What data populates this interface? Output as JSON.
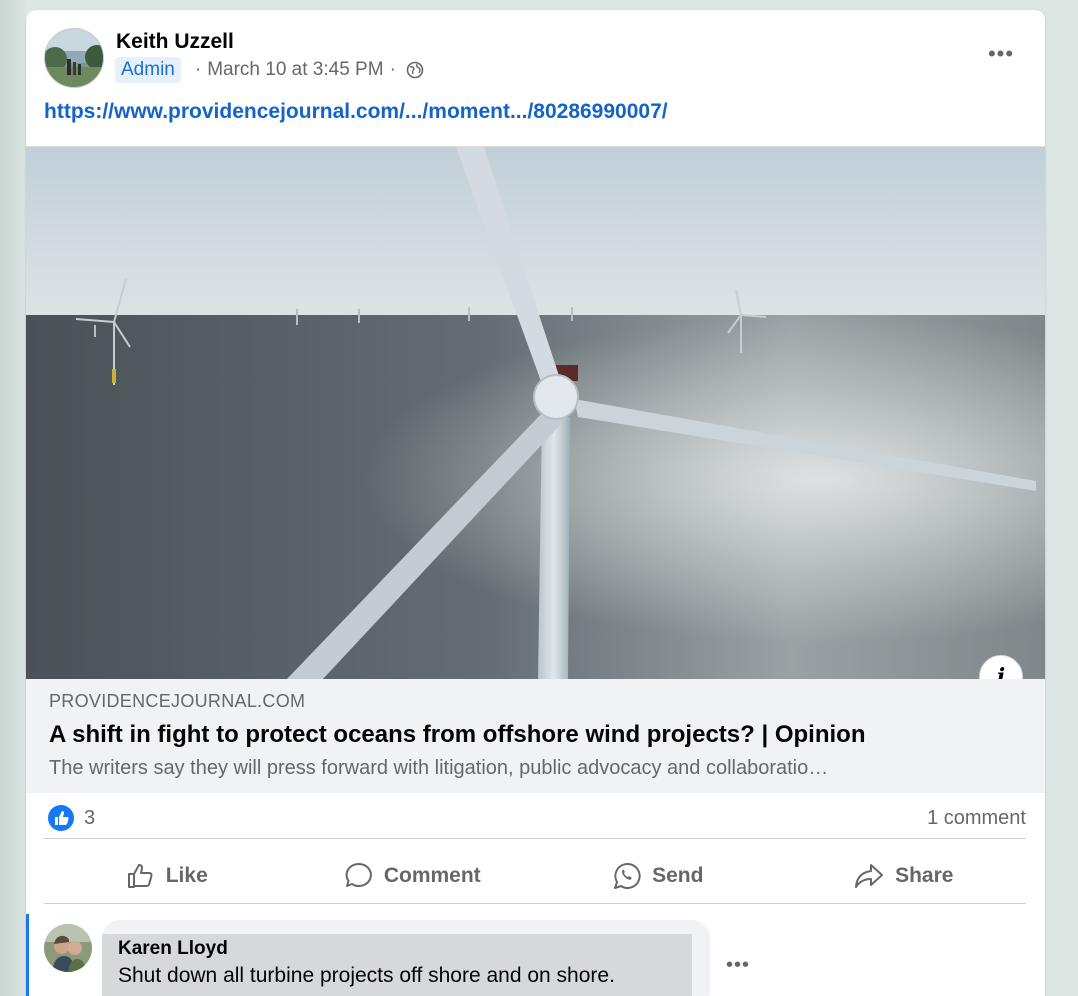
{
  "post": {
    "author": "Keith Uzzell",
    "badge": "Admin",
    "date": "March 10 at 3:45 PM",
    "more": "•••",
    "link": "https://www.providencejournal.com/.../moment.../80286990007/"
  },
  "preview": {
    "domain": "PROVIDENCEJOURNAL.COM",
    "title": "A shift in fight to protect oceans from offshore wind projects? | Opinion",
    "description": "The writers say they will press forward with litigation, public advocacy and collaboratio…",
    "info": "i"
  },
  "stats": {
    "reactions": "3",
    "comments": "1 comment"
  },
  "actions": {
    "like": "Like",
    "comment": "Comment",
    "send": "Send",
    "share": "Share"
  },
  "comment": {
    "author": "Karen Lloyd",
    "text": "Shut down all turbine projects off shore and on shore.",
    "more": "•••"
  },
  "colors": {
    "accent": "#1877f2",
    "link": "#1464c8",
    "secondary_text": "#65676b"
  }
}
